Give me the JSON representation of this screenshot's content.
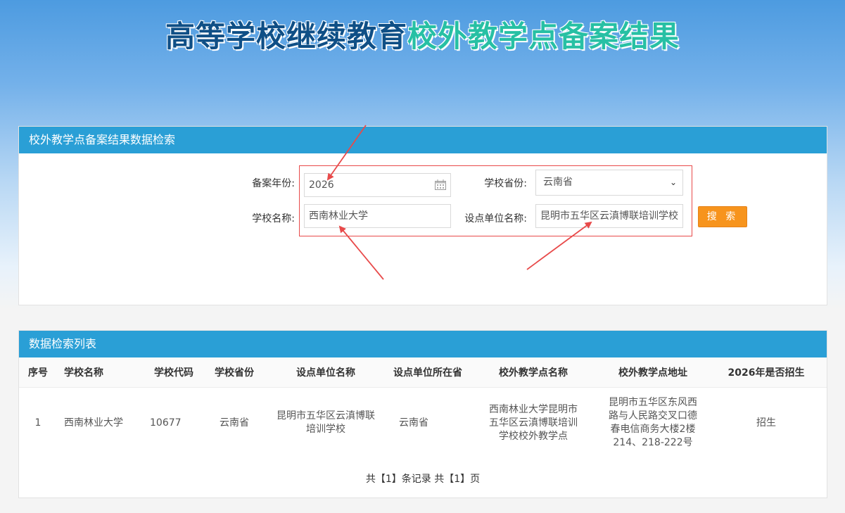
{
  "header": {
    "title_part1": "高等学校继续教育",
    "title_part2": "校外教学点备案结果"
  },
  "search": {
    "panel_title": "校外教学点备案结果数据检索",
    "year_label": "备案年份:",
    "year_value": "2026",
    "province_label": "学校省份:",
    "province_value": "云南省",
    "school_label": "学校名称:",
    "school_value": "西南林业大学",
    "unit_label": "设点单位名称:",
    "unit_value": "昆明市五华区云滇博联培训学校",
    "search_button": "搜 索"
  },
  "results": {
    "panel_title": "数据检索列表",
    "columns": [
      "序号",
      "学校名称",
      "学校代码",
      "学校省份",
      "设点单位名称",
      "设点单位所在省",
      "校外教学点名称",
      "校外教学点地址",
      "2026年是否招生"
    ],
    "rows": [
      {
        "index": "1",
        "school": "西南林业大学",
        "code": "10677",
        "province": "云南省",
        "unit": "昆明市五华区云滇博联培训学校",
        "unit_province": "云南省",
        "site_name": "西南林业大学昆明市五华区云滇博联培训学校校外教学点",
        "site_address": "昆明市五华区东风西路与人民路交叉口德春电信商务大楼2楼214、218-222号",
        "recruiting": "招生"
      }
    ],
    "pager": "共【1】条记录 共【1】页"
  },
  "colors": {
    "panel_header": "#2a9fd6",
    "search_button": "#f7941d",
    "highlight": "#e84a4a",
    "title_dark": "#0f4f86",
    "title_teal": "#27c0a4"
  }
}
